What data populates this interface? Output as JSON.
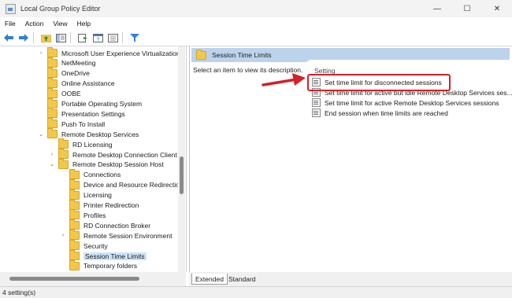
{
  "window": {
    "title": "Local Group Policy Editor",
    "controls": {
      "minimize": "—",
      "maximize": "☐",
      "close": "✕"
    }
  },
  "menu": [
    "File",
    "Action",
    "View",
    "Help"
  ],
  "tree": {
    "items": [
      {
        "label": "Microsoft User Experience Virtualization",
        "expander": "›",
        "selected": false
      },
      {
        "label": "NetMeeting",
        "expander": "",
        "selected": false
      },
      {
        "label": "OneDrive",
        "expander": "",
        "selected": false
      },
      {
        "label": "Online Assistance",
        "expander": "",
        "selected": false
      },
      {
        "label": "OOBE",
        "expander": "",
        "selected": false
      },
      {
        "label": "Portable Operating System",
        "expander": "",
        "selected": false
      },
      {
        "label": "Presentation Settings",
        "expander": "",
        "selected": false
      },
      {
        "label": "Push To Install",
        "expander": "",
        "selected": false
      },
      {
        "label": "Remote Desktop Services",
        "expander": "⌄",
        "selected": false
      },
      {
        "label": "RD Licensing",
        "expander": "",
        "selected": false
      },
      {
        "label": "Remote Desktop Connection Client",
        "expander": "›",
        "selected": false
      },
      {
        "label": "Remote Desktop Session Host",
        "expander": "⌄",
        "selected": false
      },
      {
        "label": "Connections",
        "expander": "",
        "selected": false
      },
      {
        "label": "Device and Resource Redirection",
        "expander": "",
        "selected": false
      },
      {
        "label": "Licensing",
        "expander": "",
        "selected": false
      },
      {
        "label": "Printer Redirection",
        "expander": "",
        "selected": false
      },
      {
        "label": "Profiles",
        "expander": "",
        "selected": false
      },
      {
        "label": "RD Connection Broker",
        "expander": "",
        "selected": false
      },
      {
        "label": "Remote Session Environment",
        "expander": "›",
        "selected": false
      },
      {
        "label": "Security",
        "expander": "",
        "selected": false
      },
      {
        "label": "Session Time Limits",
        "expander": "",
        "selected": true
      },
      {
        "label": "Temporary folders",
        "expander": "",
        "selected": false
      }
    ]
  },
  "right_pane": {
    "header": "Session Time Limits",
    "description": "Select an item to view its description.",
    "column_header": "Setting",
    "settings": [
      "Set time limit for disconnected sessions",
      "Set time limit for active but idle Remote Desktop Services ses...",
      "Set time limit for active Remote Desktop Services sessions",
      "End session when time limits are reached"
    ]
  },
  "tabs": {
    "extended": "Extended",
    "standard": "Standard"
  },
  "status": "4 setting(s)",
  "colors": {
    "highlight": "#d42027",
    "header_bg": "#bcd3ec",
    "selected_bg": "#cce4f7",
    "folder": "#f2c84b"
  }
}
